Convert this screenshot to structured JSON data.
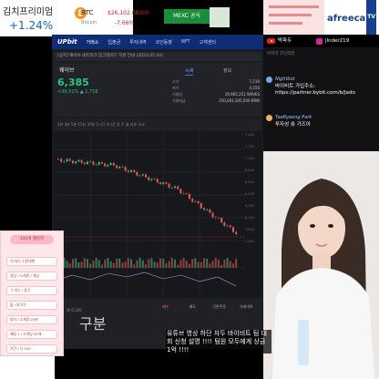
{
  "kimchi": {
    "title": "김치프리미엄",
    "value": "+1.24%"
  },
  "btc": {
    "symbol": "BTC",
    "name": "Bitcoin",
    "price": "$26,102.08000",
    "change": "-7.66%"
  },
  "mexc": {
    "label": "MEXC 공식"
  },
  "afreeca": {
    "brand": "afreeca",
    "tv": "TV"
  },
  "upbit": {
    "logo": "UPbit",
    "nav": [
      "거래소",
      "입출금",
      "투자내역",
      "코인동향",
      "NFT",
      "고객센터"
    ],
    "notice": "[공지] 웨이브 네트워크 업그레이드 지원 안내 (2023.05.10)",
    "coin": {
      "name": "웨이브",
      "price": "6,385",
      "change": "+36.51%  ▲ 1,716"
    },
    "tabs": {
      "krw": "시세",
      "info": "정보"
    },
    "stats": [
      {
        "k": "고가",
        "v": "7,210"
      },
      {
        "k": "저가",
        "v": "4,550"
      },
      {
        "k": "거래량",
        "v": "39,905,251 WAVES"
      },
      {
        "k": "거래대금",
        "v": "250,001,345,500 KRW"
      }
    ],
    "chart_toolbar": "1분   3분   5분   15분   30분   1시간   4시간   일   주   월   지표   비교",
    "price_axis": [
      "7,400",
      "7,200",
      "7,000",
      "6,800",
      "6,600",
      "6,400",
      "6,200",
      "6,000",
      "5,800",
      "5,600"
    ],
    "order": {
      "big": "구분",
      "sub": "W 6,385",
      "tabs": [
        "매수",
        "매도",
        "간편주문",
        "거래내역"
      ]
    }
  },
  "event": {
    "title": "100개 챌린지",
    "items": [
      "식사/다 소원대행",
      "영상 / 노래방 / 게임",
      "그 쉬는 / 휴식",
      "술 / 닭고기",
      "밥사 / 소개팅 20분",
      "배팅 1 / 소개팅 50개",
      "기간 / 다 100"
    ]
  },
  "stream": {
    "channel": "박파두",
    "instagram": "jlnder219",
    "top_line": "마지막 코인작전",
    "chats": [
      {
        "user": "Nightbot",
        "text": "바이비트 가입주소: https://partner.bybit.com/b/Jado"
      },
      {
        "user": "TaeRyeong Park",
        "text": "투자성 숏 가즈아"
      }
    ]
  },
  "caption": "유튜브 영상 하단 자두 바이비트 팀 대회 신청 설명 !!!! 팀원 모두에게 상금 1억 !!!!"
}
